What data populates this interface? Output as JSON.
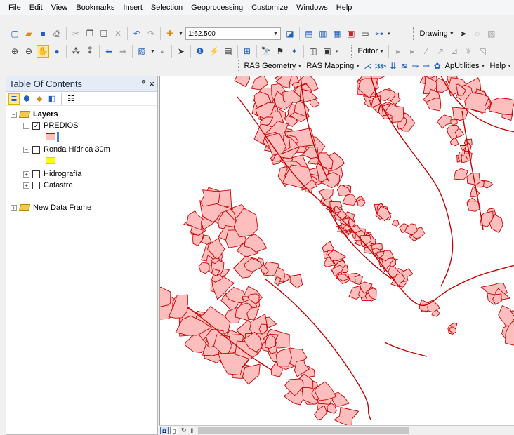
{
  "menu": [
    "File",
    "Edit",
    "View",
    "Bookmarks",
    "Insert",
    "Selection",
    "Geoprocessing",
    "Customize",
    "Windows",
    "Help"
  ],
  "toolbar": {
    "scale_value": "1:62.500",
    "drawing_label": "Drawing",
    "editor_label": "Editor",
    "ras_geometry_label": "RAS Geometry",
    "ras_mapping_label": "RAS Mapping",
    "aputilities_label": "ApUtilities",
    "help_label": "Help"
  },
  "toc": {
    "title": "Table Of Contents",
    "pin": "ᵠ",
    "close": "×",
    "data_frame": "Layers",
    "layers": [
      {
        "name": "PREDIOS",
        "checked": true,
        "swatch_color": "#ffbebe",
        "outline_color": "#c80000"
      },
      {
        "name": "Ronda Hídrica 30m",
        "checked": false,
        "swatch_color": "#ffff00"
      },
      {
        "name": "Hidrografía",
        "checked": false
      },
      {
        "name": "Catastro",
        "checked": false
      }
    ],
    "new_data_frame": "New Data Frame"
  },
  "colors": {
    "parcel_fill": "#ffbebe",
    "parcel_outline": "#c80000",
    "river_line": "#c80000",
    "toc_header": "#e6ecf5"
  }
}
